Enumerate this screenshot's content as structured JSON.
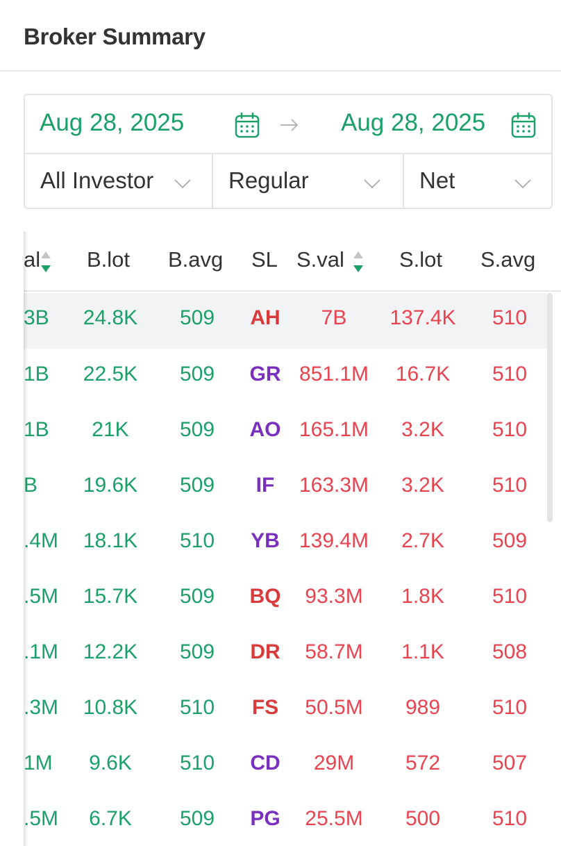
{
  "header": {
    "title": "Broker Summary"
  },
  "filters": {
    "start_date": "Aug 28, 2025",
    "end_date": "Aug 28, 2025",
    "investor": "All Investor",
    "market": "Regular",
    "mode": "Net"
  },
  "colors": {
    "buy": "#1aa068",
    "sell": "#e8434f",
    "code_purple": "#7b2fbe",
    "code_red": "#d93a3a"
  },
  "table": {
    "columns": {
      "b_val": "al",
      "b_lot": "B.lot",
      "b_avg": "B.avg",
      "sl": "SL",
      "s_val": "S.val",
      "s_lot": "S.lot",
      "s_avg": "S.avg"
    },
    "rows": [
      {
        "b_val": "3B",
        "b_lot": "24.8K",
        "b_avg": "509",
        "sl": "AH",
        "sl_color": "red",
        "s_val": "7B",
        "s_lot": "137.4K",
        "s_avg": "510"
      },
      {
        "b_val": "1B",
        "b_lot": "22.5K",
        "b_avg": "509",
        "sl": "GR",
        "sl_color": "purple",
        "s_val": "851.1M",
        "s_lot": "16.7K",
        "s_avg": "510"
      },
      {
        "b_val": "1B",
        "b_lot": "21K",
        "b_avg": "509",
        "sl": "AO",
        "sl_color": "purple",
        "s_val": "165.1M",
        "s_lot": "3.2K",
        "s_avg": "510"
      },
      {
        "b_val": "B",
        "b_lot": "19.6K",
        "b_avg": "509",
        "sl": "IF",
        "sl_color": "purple",
        "s_val": "163.3M",
        "s_lot": "3.2K",
        "s_avg": "510"
      },
      {
        "b_val": ".4M",
        "b_lot": "18.1K",
        "b_avg": "510",
        "sl": "YB",
        "sl_color": "purple",
        "s_val": "139.4M",
        "s_lot": "2.7K",
        "s_avg": "509"
      },
      {
        "b_val": ".5M",
        "b_lot": "15.7K",
        "b_avg": "509",
        "sl": "BQ",
        "sl_color": "red",
        "s_val": "93.3M",
        "s_lot": "1.8K",
        "s_avg": "510"
      },
      {
        "b_val": ".1M",
        "b_lot": "12.2K",
        "b_avg": "509",
        "sl": "DR",
        "sl_color": "red",
        "s_val": "58.7M",
        "s_lot": "1.1K",
        "s_avg": "508"
      },
      {
        "b_val": ".3M",
        "b_lot": "10.8K",
        "b_avg": "510",
        "sl": "FS",
        "sl_color": "red",
        "s_val": "50.5M",
        "s_lot": "989",
        "s_avg": "510"
      },
      {
        "b_val": "1M",
        "b_lot": "9.6K",
        "b_avg": "510",
        "sl": "CD",
        "sl_color": "purple",
        "s_val": "29M",
        "s_lot": "572",
        "s_avg": "507"
      },
      {
        "b_val": ".5M",
        "b_lot": "6.7K",
        "b_avg": "509",
        "sl": "PG",
        "sl_color": "purple",
        "s_val": "25.5M",
        "s_lot": "500",
        "s_avg": "510"
      }
    ]
  }
}
